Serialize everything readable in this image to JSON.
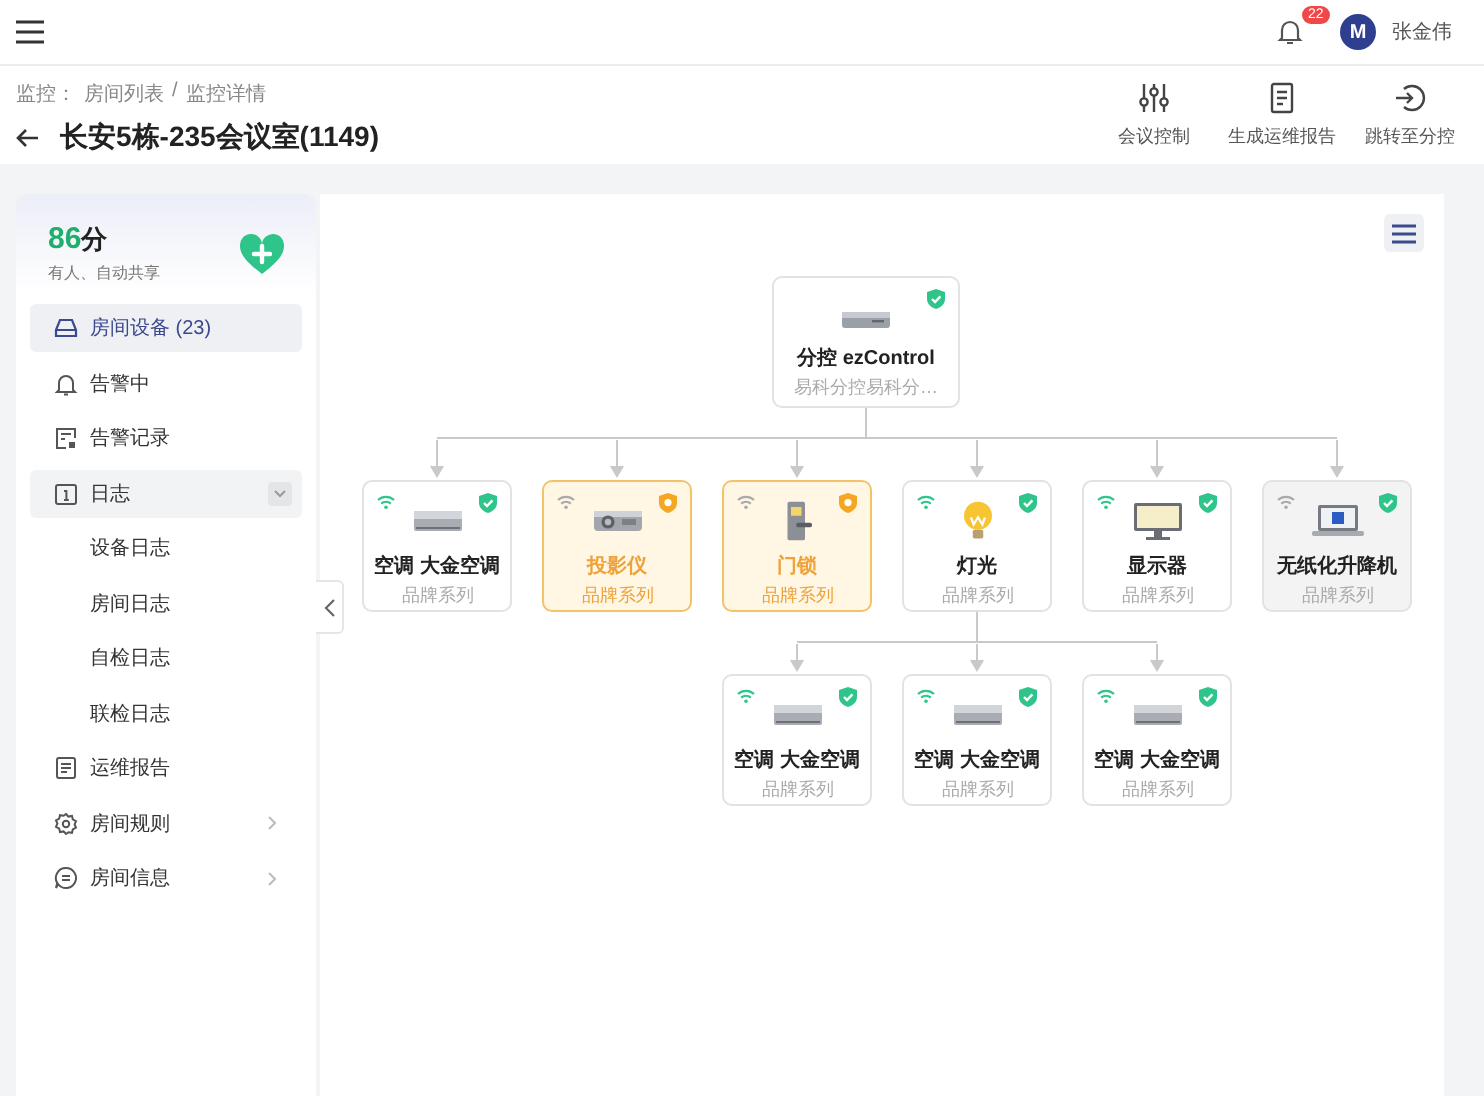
{
  "topbar": {
    "notification_count": "22",
    "user": {
      "initial": "M",
      "name": "张金伟"
    }
  },
  "breadcrumb": {
    "prefix": "监控：",
    "separator": "/",
    "items": [
      "房间列表",
      "监控详情"
    ]
  },
  "title": "长安5栋-235会议室(1149)",
  "actions": [
    {
      "kind": "sliders",
      "label": "会议控制"
    },
    {
      "kind": "document",
      "label": "生成运维报告"
    },
    {
      "kind": "enter",
      "label": "跳转至分控"
    }
  ],
  "sidebar": {
    "score": "86",
    "score_unit": "分",
    "status": "有人、自动共享",
    "menu": [
      {
        "kind": "device",
        "label": "房间设备 (23)",
        "selected": true
      },
      {
        "kind": "bell",
        "label": "告警中",
        "selected": false
      },
      {
        "kind": "record",
        "label": "告警记录",
        "selected": false
      },
      {
        "kind": "log",
        "label": "日志",
        "selected": false,
        "expanded": true,
        "children": [
          {
            "label": "设备日志",
            "selected": false
          },
          {
            "label": "房间日志",
            "selected": false
          },
          {
            "label": "自检日志",
            "selected": false
          },
          {
            "label": "联检日志",
            "selected": false
          }
        ]
      },
      {
        "kind": "report",
        "label": "运维报告",
        "selected": false
      },
      {
        "kind": "rules",
        "label": "房间规则",
        "selected": false,
        "expanded": false
      },
      {
        "kind": "info",
        "label": "房间信息",
        "selected": false,
        "expanded": false
      }
    ]
  },
  "topology": {
    "root": {
      "kind": "gateway",
      "name": "分控 ezControl",
      "subtitle": "易科分控易科分…",
      "alert": false,
      "offline": false
    },
    "devices": [
      {
        "kind": "ac",
        "name": "空调 大金空调",
        "subtitle": "品牌系列",
        "alert": false,
        "offline": false,
        "connected": true
      },
      {
        "kind": "projector",
        "name": "投影仪",
        "subtitle": "品牌系列",
        "alert": true,
        "offline": false,
        "connected": false
      },
      {
        "kind": "lock",
        "name": "门锁",
        "subtitle": "品牌系列",
        "alert": true,
        "offline": false,
        "connected": false
      },
      {
        "kind": "light",
        "name": "灯光",
        "subtitle": "品牌系列",
        "alert": false,
        "offline": false,
        "connected": true,
        "children": [
          {
            "kind": "ac",
            "name": "空调 大金空调",
            "subtitle": "品牌系列",
            "alert": false,
            "offline": false,
            "connected": true
          },
          {
            "kind": "ac",
            "name": "空调 大金空调",
            "subtitle": "品牌系列",
            "alert": false,
            "offline": false,
            "connected": true
          },
          {
            "kind": "ac",
            "name": "空调 大金空调",
            "subtitle": "品牌系列",
            "alert": false,
            "offline": false,
            "connected": true
          }
        ]
      },
      {
        "kind": "monitor",
        "name": "显示器",
        "subtitle": "品牌系列",
        "alert": false,
        "offline": false,
        "connected": true
      },
      {
        "kind": "laptop",
        "name": "无纸化升降机",
        "subtitle": "品牌系列",
        "alert": false,
        "offline": true,
        "connected": false
      }
    ]
  }
}
